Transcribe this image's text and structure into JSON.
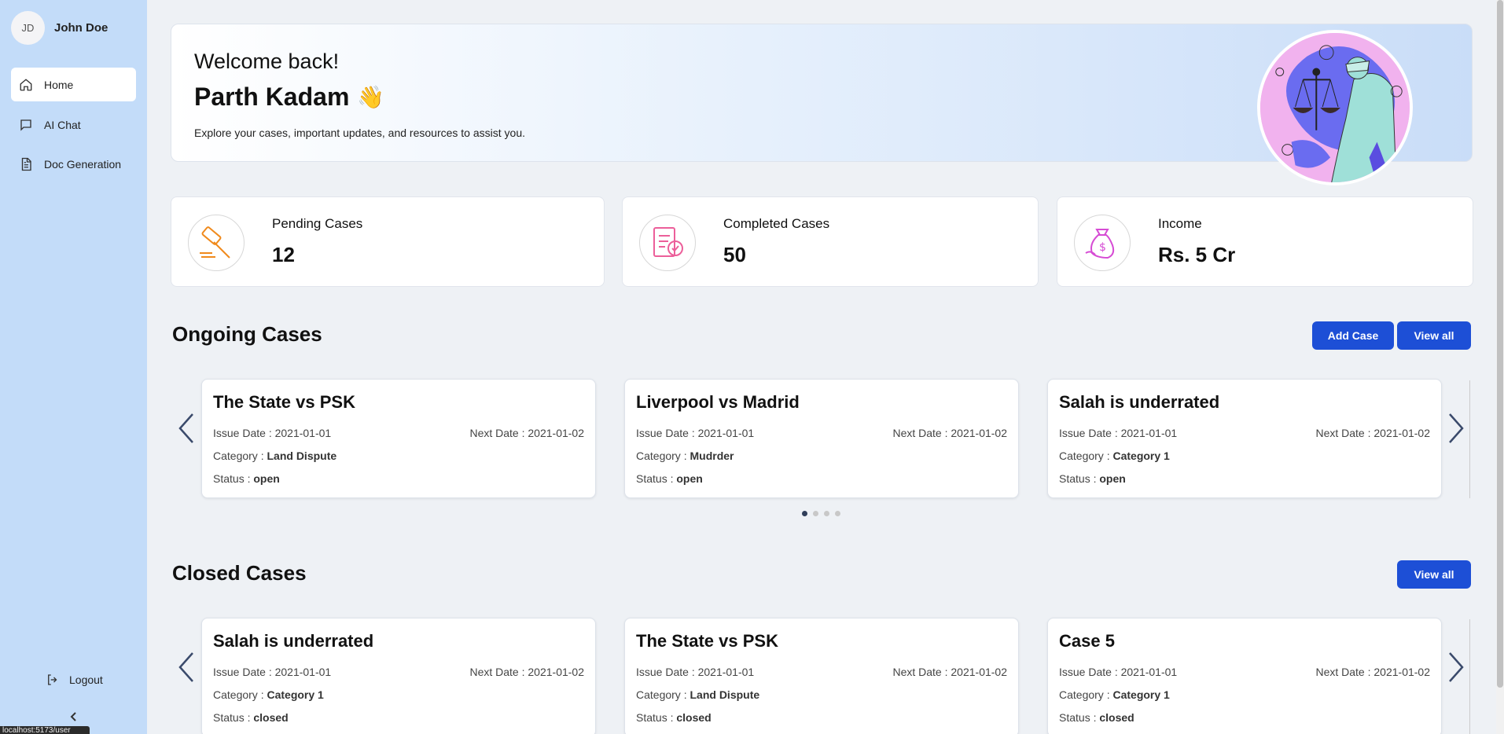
{
  "sidebar": {
    "user": {
      "initials": "JD",
      "name": "John Doe"
    },
    "items": [
      {
        "label": "Home",
        "icon": "home-icon",
        "active": true
      },
      {
        "label": "AI Chat",
        "icon": "chat-icon",
        "active": false
      },
      {
        "label": "Doc Generation",
        "icon": "document-icon",
        "active": false
      }
    ],
    "logout_label": "Logout"
  },
  "status_bar": {
    "url": "localhost:5173/user"
  },
  "welcome": {
    "greeting": "Welcome back!",
    "name": "Parth Kadam",
    "emoji": "👋",
    "subtitle": "Explore your cases, important updates, and resources to assist you."
  },
  "stats": [
    {
      "label": "Pending Cases",
      "value": "12",
      "icon": "gavel-icon",
      "color": "#f08a1c"
    },
    {
      "label": "Completed Cases",
      "value": "50",
      "icon": "checklist-icon",
      "color": "#ec5f9a"
    },
    {
      "label": "Income",
      "value": "Rs. 5 Cr",
      "icon": "money-bag-icon",
      "color": "#d64bd4"
    }
  ],
  "ongoing": {
    "title": "Ongoing Cases",
    "add_label": "Add Case",
    "view_all_label": "View all",
    "cards": [
      {
        "title": "The State vs PSK",
        "issue": "Issue Date : 2021-01-01",
        "next": "Next Date : 2021-01-02",
        "category_label": "Category : ",
        "category": "Land Dispute",
        "status_label": "Status : ",
        "status": "open"
      },
      {
        "title": "Liverpool vs Madrid",
        "issue": "Issue Date : 2021-01-01",
        "next": "Next Date : 2021-01-02",
        "category_label": "Category : ",
        "category": "Mudrder",
        "status_label": "Status : ",
        "status": "open"
      },
      {
        "title": "Salah is underrated",
        "issue": "Issue Date : 2021-01-01",
        "next": "Next Date : 2021-01-02",
        "category_label": "Category : ",
        "category": "Category 1",
        "status_label": "Status : ",
        "status": "open"
      }
    ],
    "dots": 4,
    "active_dot": 0
  },
  "closed": {
    "title": "Closed Cases",
    "view_all_label": "View all",
    "cards": [
      {
        "title": "Salah is underrated",
        "issue": "Issue Date : 2021-01-01",
        "next": "Next Date : 2021-01-02",
        "category_label": "Category : ",
        "category": "Category 1",
        "status_label": "Status : ",
        "status": "closed"
      },
      {
        "title": "The State vs PSK",
        "issue": "Issue Date : 2021-01-01",
        "next": "Next Date : 2021-01-02",
        "category_label": "Category : ",
        "category": "Land Dispute",
        "status_label": "Status : ",
        "status": "closed"
      },
      {
        "title": "Case 5",
        "issue": "Issue Date : 2021-01-01",
        "next": "Next Date : 2021-01-02",
        "category_label": "Category : ",
        "category": "Category 1",
        "status_label": "Status : ",
        "status": "closed"
      }
    ]
  },
  "colors": {
    "sidebar": "#c3dcf9",
    "primary_button": "#1d4fd6",
    "background": "#eef1f5"
  }
}
